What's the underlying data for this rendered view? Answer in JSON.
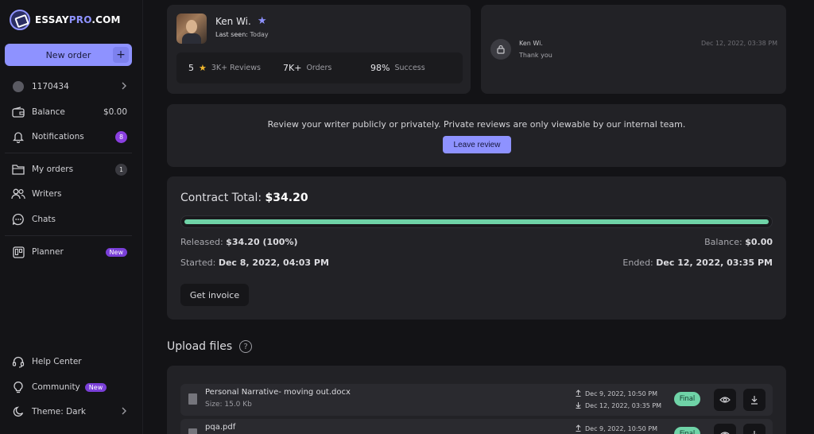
{
  "brand": {
    "name_part1": "ESSAY",
    "name_part2": "PRO",
    "name_part3": ".COM"
  },
  "sidebar": {
    "new_order": "New order",
    "new_order_plus": "+",
    "user_id": "1170434",
    "balance_label": "Balance",
    "balance_value": "$0.00",
    "notifications_label": "Notifications",
    "notifications_count": "8",
    "my_orders_label": "My orders",
    "my_orders_count": "1",
    "writers_label": "Writers",
    "chats_label": "Chats",
    "planner_label": "Planner",
    "planner_badge": "New",
    "help_center_label": "Help Center",
    "community_label": "Community",
    "community_badge": "New",
    "theme_label": "Theme: Dark"
  },
  "writer": {
    "name": "Ken Wi.",
    "last_seen_label": "Last seen:",
    "last_seen_value": "Today",
    "rating": "5",
    "reviews": "3K+ Reviews",
    "orders_value": "7K+",
    "orders_label": "Orders",
    "success_value": "98%",
    "success_label": "Success"
  },
  "chat": {
    "name": "Ken Wi.",
    "message": "Thank you",
    "time": "Dec 12, 2022, 03:38 PM"
  },
  "review": {
    "text": "Review your writer publicly or privately. Private reviews are only viewable by our internal team.",
    "button": "Leave review"
  },
  "contract": {
    "title_label": "Contract Total:",
    "title_value": "$34.20",
    "progress_fraction": 1.0,
    "released_label": "Released:",
    "released_value": "$34.20 (100%)",
    "balance_label": "Balance:",
    "balance_value": "$0.00",
    "started_label": "Started:",
    "started_value": "Dec 8, 2022, 04:03 PM",
    "ended_label": "Ended:",
    "ended_value": "Dec 12, 2022, 03:35 PM",
    "invoice_button": "Get invoice"
  },
  "uploads": {
    "title": "Upload files",
    "help": "?",
    "files": [
      {
        "name": "Personal Narrative- moving out.docx",
        "size": "Size: 15.0 Kb",
        "uploaded": "Dec 9, 2022, 10:50 PM",
        "downloaded": "Dec 12, 2022, 03:35 PM",
        "status": "Final"
      },
      {
        "name": "pqa.pdf",
        "uploaded": "Dec 9, 2022, 10:50 PM",
        "status": "Final"
      }
    ]
  },
  "colors": {
    "accent": "#8e92ff",
    "success": "#6fd3a7",
    "badge": "#7a3fd8"
  }
}
